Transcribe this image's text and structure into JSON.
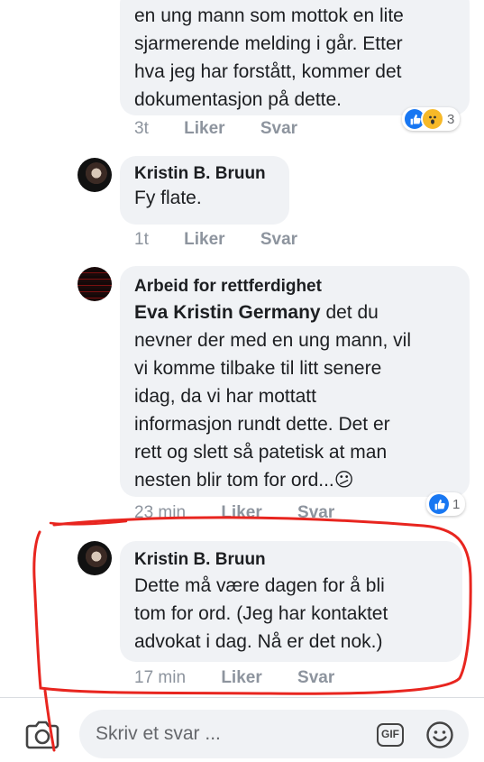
{
  "comments": [
    {
      "text": "en ung mann som mottok en lite sjarmerende melding i går. Etter hva jeg har forstått, kommer det dokumentasjon på dette.",
      "lines": [
        "en ung mann som mottok en lite",
        "sjarmerende melding i går. Etter",
        "hva jeg har forstått, kommer det",
        "dokumentasjon på dette."
      ],
      "time": "3t",
      "like_label": "Liker",
      "reply_label": "Svar",
      "reaction_count": "3"
    },
    {
      "author": "Kristin B. Bruun",
      "text": "Fy flate.",
      "time": "1t",
      "like_label": "Liker",
      "reply_label": "Svar"
    },
    {
      "author": "Arbeid for rettferdighet",
      "mention": "Eva Kristin Germany",
      "lines": [
        "det du",
        "nevner der med en ung mann, vil",
        "vi komme tilbake til litt senere",
        "idag, da vi har mottatt",
        "informasjon rundt dette. Det er",
        "rett og slett så patetisk at man",
        "nesten blir tom for ord..."
      ],
      "emoji": "😕",
      "time": "23 min",
      "like_label": "Liker",
      "reply_label": "Svar",
      "reaction_count": "1"
    },
    {
      "author": "Kristin B. Bruun",
      "lines": [
        "Dette må være dagen for å bli",
        "tom for ord. (Jeg har kontaktet",
        "advokat i dag. Nå er det nok.)"
      ],
      "time": "17 min",
      "like_label": "Liker",
      "reply_label": "Svar"
    }
  ],
  "composer": {
    "placeholder": "Skriv et svar ...",
    "gif_label": "GIF",
    "camera_icon": "camera-icon",
    "emoji_icon": "emoji-icon"
  },
  "colors": {
    "bubble": "#f0f2f5",
    "meta": "#8d949e",
    "like_blue": "#1877f2",
    "annotation_red": "#e8251f"
  }
}
